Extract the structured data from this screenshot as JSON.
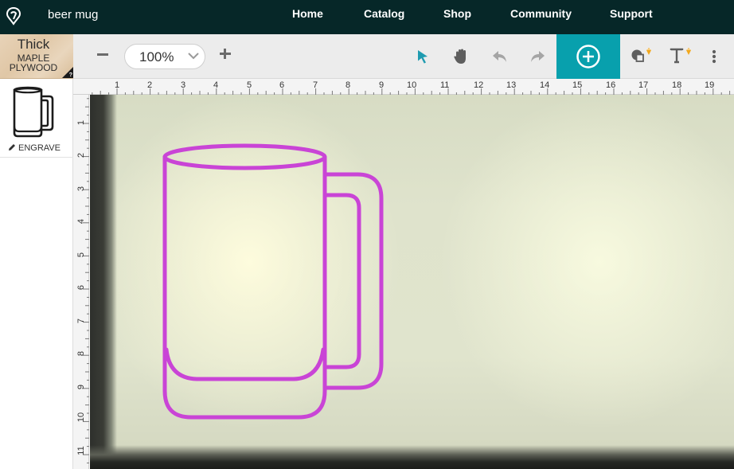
{
  "app": {
    "document_title": "beer mug"
  },
  "nav": {
    "links": [
      "Home",
      "Catalog",
      "Shop",
      "Community",
      "Support"
    ]
  },
  "material": {
    "thickness": "Thick",
    "name_line1": "MAPLE",
    "name_line2": "PLYWOOD",
    "help_icon": "?"
  },
  "toolbar": {
    "zoom_value": "100%",
    "icons": [
      "minus-icon",
      "chevron-down-icon",
      "plus-icon",
      "pointer-icon",
      "hand-icon",
      "undo-icon",
      "redo-icon",
      "add-circle-icon",
      "shapes-icon",
      "text-icon",
      "more-vertical-icon"
    ],
    "accent_color": "#08a0ad"
  },
  "designs": [
    {
      "name": "beer mug",
      "operation": "ENGRAVE"
    }
  ],
  "rulers": {
    "top": [
      "1",
      "2",
      "3",
      "4",
      "5",
      "6",
      "7",
      "8",
      "9",
      "10",
      "11",
      "12",
      "13",
      "14",
      "15",
      "16",
      "17",
      "18",
      "19"
    ],
    "left": [
      "1",
      "2",
      "3",
      "4",
      "5",
      "6",
      "7",
      "8",
      "9",
      "10",
      "11"
    ]
  },
  "canvas": {
    "artwork_color": "#c944d6"
  }
}
